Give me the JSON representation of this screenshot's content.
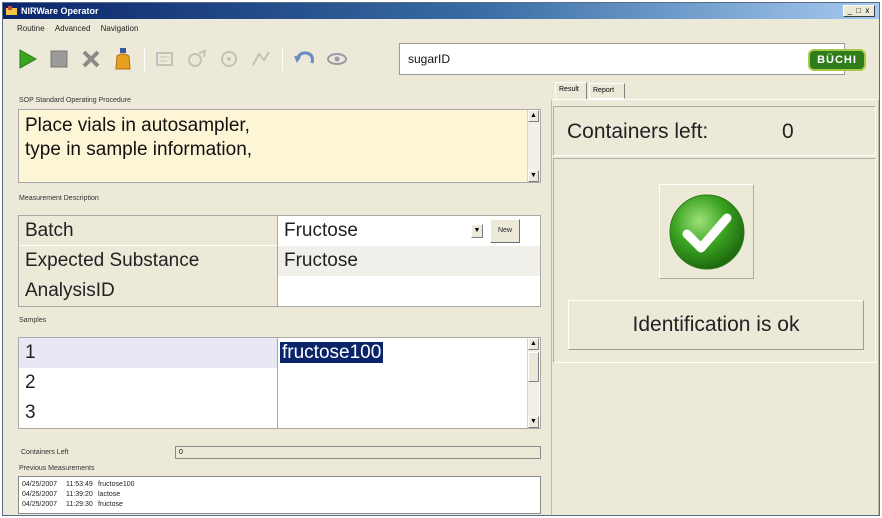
{
  "window": {
    "title": "NIRWare Operator",
    "controls": "_ □ x"
  },
  "menu": [
    "Routine",
    "Advanced",
    "Navigation"
  ],
  "toolbar": {
    "icons": [
      "run-icon",
      "stop-icon",
      "cancel-icon",
      "bottle-icon",
      "disabled-tool-icon",
      "disabled-tool-icon",
      "disabled-tool-icon",
      "disabled-tool-icon",
      "undo-arrow-icon",
      "eye-icon"
    ],
    "search_value": "sugarID",
    "logo_text": "BÜCHI"
  },
  "sop": {
    "label": "SOP Standard Operating Procedure",
    "line1": "Place vials in autosampler,",
    "line2": "type in sample information,"
  },
  "measurement": {
    "label": "Measurement Description",
    "batch_label": "Batch",
    "batch_value": "Fructose",
    "new_button": "New",
    "substance_label": "Expected Substance",
    "substance_value": "Fructose",
    "analysis_label": "AnalysisID",
    "analysis_value": ""
  },
  "samples": {
    "label": "Samples",
    "rows": [
      {
        "num": "1",
        "value": "fructose100"
      },
      {
        "num": "2",
        "value": ""
      },
      {
        "num": "3",
        "value": ""
      }
    ]
  },
  "containers_left_small": {
    "label": "Containers Left",
    "value": "0"
  },
  "previous": {
    "label": "Previous Measurements",
    "rows": [
      {
        "date": "04/25/2007",
        "time": "11:53:49",
        "name": "fructose100"
      },
      {
        "date": "04/25/2007",
        "time": "11:39:20",
        "name": "lactose"
      },
      {
        "date": "04/25/2007",
        "time": "11:29:30",
        "name": "fructose"
      }
    ]
  },
  "result_panel": {
    "tabs": [
      "Result",
      "Report"
    ],
    "active_tab": "Result",
    "containers_label": "Containers left:",
    "containers_value": "0",
    "status_text": "Identification is ok"
  },
  "colors": {
    "title_bar": "#0a246a",
    "sop_background": "#fdf6d6",
    "selection": "#0a246a",
    "ok_green": "#3aa321",
    "logo_green": "#2f7d1a"
  }
}
